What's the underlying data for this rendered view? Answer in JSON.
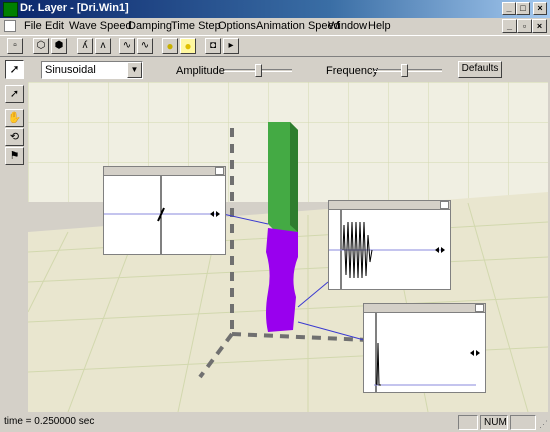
{
  "titlebar": {
    "title": "Dr. Layer - [Dri.Win1]"
  },
  "menu": [
    "File",
    "Edit",
    "Wave Speed",
    "Damping",
    "Time Step",
    "Options",
    "Animation Speed",
    "Window",
    "Help"
  ],
  "toolbar": {
    "icons": [
      "new-document-icon",
      "cube-wireframe-icon",
      "cube-solid-icon",
      "wave-left-icon",
      "wave-right-icon",
      "waveform-a-icon",
      "waveform-b-icon",
      "lightbulb-icon",
      "lightbulb-on-icon",
      "play-pause-icon",
      "record-icon"
    ]
  },
  "controls": {
    "waveform_select": "Sinusoidal",
    "amplitude_label": "Amplitude",
    "amplitude_value": 0.5,
    "frequency_label": "Frequency",
    "frequency_value": 0.45,
    "defaults_label": "Defaults"
  },
  "left_tools": [
    "pointer-icon",
    "hand-icon",
    "rotate-icon",
    "flag-icon"
  ],
  "scene": {
    "column_top_color": "#44aa44",
    "column_bottom_color": "#9900ee",
    "floor_color": "#e9e6cf",
    "grid_color": "#d2d8ae"
  },
  "status": {
    "time_text": "time = 0.250000 sec",
    "num_label": "NUM"
  }
}
